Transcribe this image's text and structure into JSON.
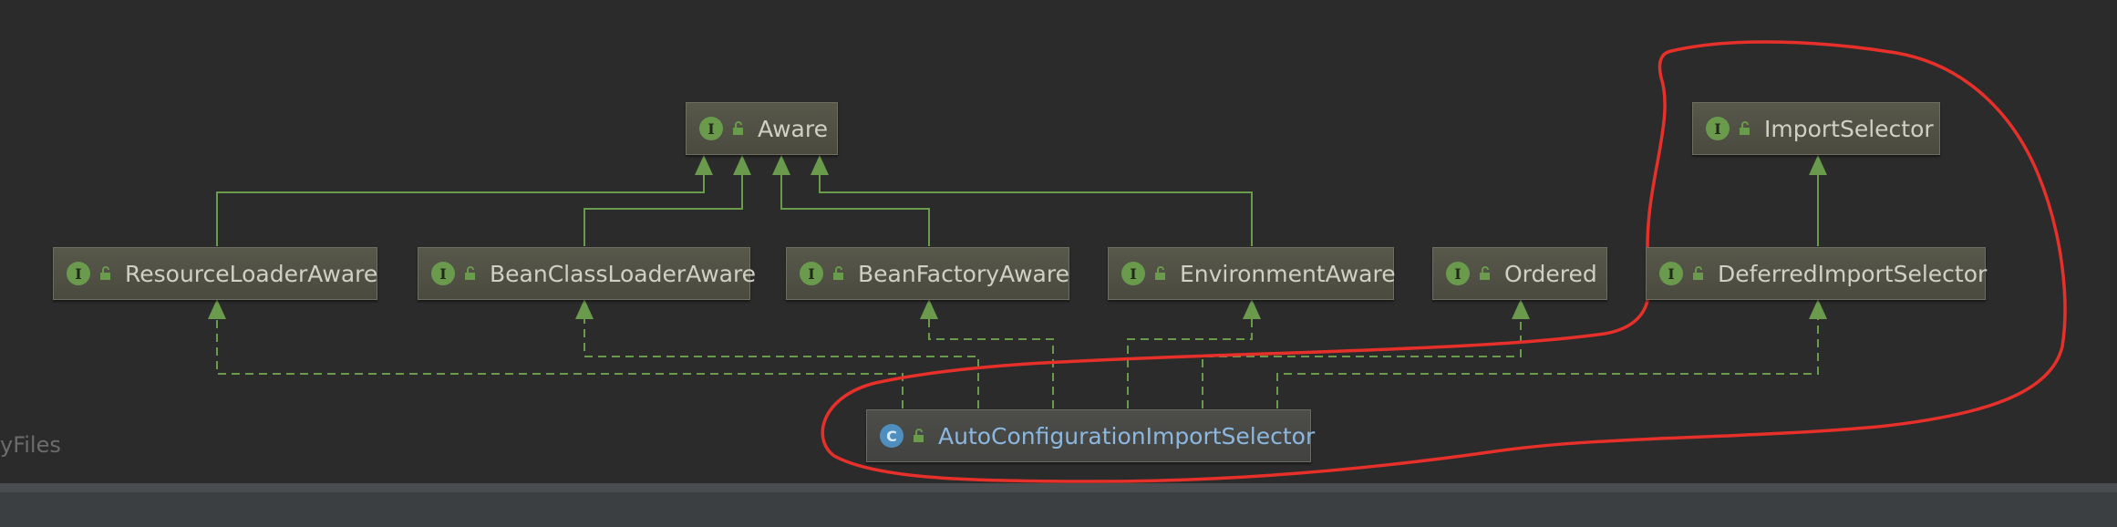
{
  "diagram": {
    "nodes": {
      "aware": {
        "label": "Aware",
        "kind": "I"
      },
      "import_selector": {
        "label": "ImportSelector",
        "kind": "I"
      },
      "resource_loader_aware": {
        "label": "ResourceLoaderAware",
        "kind": "I"
      },
      "bean_class_loader_aware": {
        "label": "BeanClassLoaderAware",
        "kind": "I"
      },
      "bean_factory_aware": {
        "label": "BeanFactoryAware",
        "kind": "I"
      },
      "environment_aware": {
        "label": "EnvironmentAware",
        "kind": "I"
      },
      "ordered": {
        "label": "Ordered",
        "kind": "I"
      },
      "deferred_import_selector": {
        "label": "DeferredImportSelector",
        "kind": "I"
      },
      "auto_configuration_import_selector": {
        "label": "AutoConfigurationImportSelector",
        "kind": "C"
      }
    },
    "edges": [
      {
        "from": "resource_loader_aware",
        "to": "aware",
        "type": "extends"
      },
      {
        "from": "bean_class_loader_aware",
        "to": "aware",
        "type": "extends"
      },
      {
        "from": "bean_factory_aware",
        "to": "aware",
        "type": "extends"
      },
      {
        "from": "environment_aware",
        "to": "aware",
        "type": "extends"
      },
      {
        "from": "deferred_import_selector",
        "to": "import_selector",
        "type": "extends"
      },
      {
        "from": "auto_configuration_import_selector",
        "to": "resource_loader_aware",
        "type": "implements"
      },
      {
        "from": "auto_configuration_import_selector",
        "to": "bean_class_loader_aware",
        "type": "implements"
      },
      {
        "from": "auto_configuration_import_selector",
        "to": "bean_factory_aware",
        "type": "implements"
      },
      {
        "from": "auto_configuration_import_selector",
        "to": "environment_aware",
        "type": "implements"
      },
      {
        "from": "auto_configuration_import_selector",
        "to": "ordered",
        "type": "implements"
      },
      {
        "from": "auto_configuration_import_selector",
        "to": "deferred_import_selector",
        "type": "implements"
      }
    ],
    "colors": {
      "edge": "#6a9a4c",
      "annotation": "#e8302b",
      "background": "#2b2b2b"
    }
  },
  "watermark": "yFiles"
}
